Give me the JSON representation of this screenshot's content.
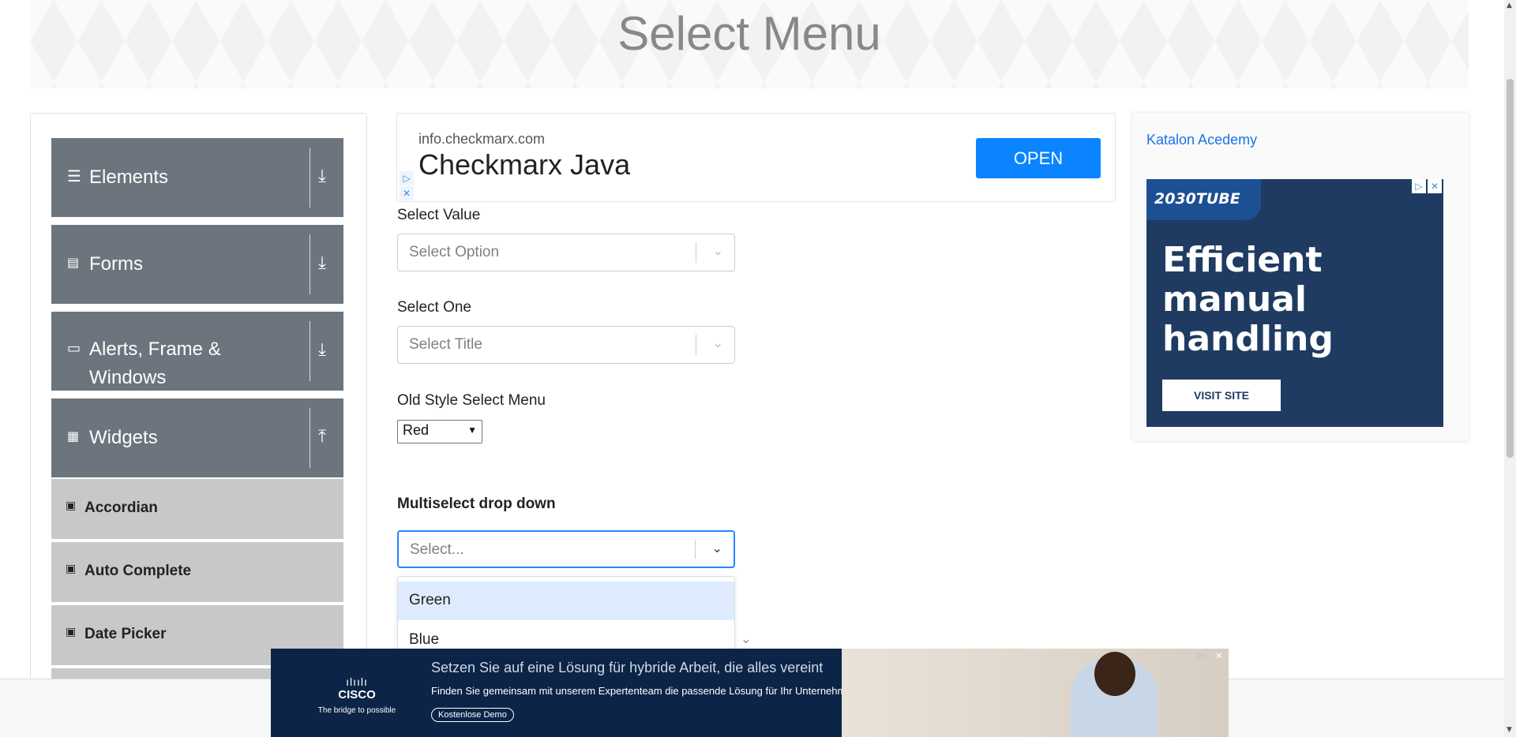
{
  "page": {
    "title": "Select Menu"
  },
  "sidebar": {
    "groups": [
      {
        "label": "Elements",
        "icon": "hamburger-icon",
        "arrow": "download-icon"
      },
      {
        "label": "Forms",
        "icon": "document-icon",
        "arrow": "download-icon"
      },
      {
        "label": "Alerts, Frame &",
        "label2": "Windows",
        "icon": "window-icon",
        "arrow": "download-icon"
      },
      {
        "label": "Widgets",
        "icon": "widgets-icon",
        "arrow": "upload-icon"
      }
    ],
    "items": [
      "Accordian",
      "Auto Complete",
      "Date Picker"
    ]
  },
  "ad_top": {
    "url": "info.checkmarx.com",
    "title": "Checkmarx Java",
    "button": "OPEN"
  },
  "form": {
    "select_value_label": "Select Value",
    "select_value_placeholder": "Select Option",
    "select_one_label": "Select One",
    "select_one_placeholder": "Select Title",
    "old_style_label": "Old Style Select Menu",
    "old_style_value": "Red",
    "multiselect_label": "Multiselect drop down",
    "multiselect_placeholder": "Select...",
    "options": [
      "Green",
      "Blue"
    ]
  },
  "ad_right": {
    "link": "Katalon Acedemy",
    "brand": "2030TUBE",
    "headline": [
      "Efficient",
      "manual",
      "handling"
    ],
    "button": "VISIT SITE"
  },
  "ad_bottom": {
    "brand": "CISCO",
    "tagline": "The bridge to possible",
    "headline": "Setzen Sie auf eine Lösung für hybride Arbeit, die alles vereint",
    "sub": "Finden Sie gemeinsam mit unserem Expertenteam die passende Lösung für Ihr Unternehmen.",
    "cta": "Kostenlose Demo"
  },
  "colors": {
    "sidebar_group": "#6c757d",
    "sidebar_item": "#c8c8c8",
    "focus": "#2684ff",
    "open_button": "#0a84ff"
  }
}
